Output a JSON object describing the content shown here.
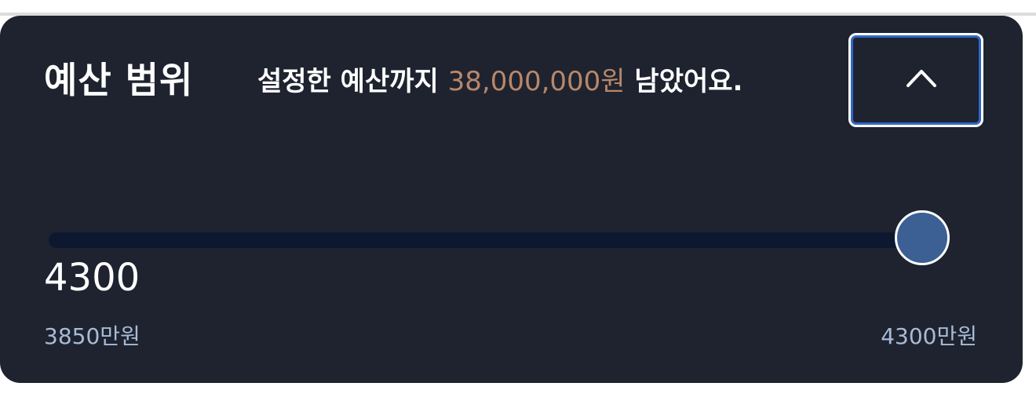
{
  "budget": {
    "title": "예산 범위",
    "message_prefix": "설정한 예산까지 ",
    "message_amount": "38,000,000원",
    "message_suffix": " 남았어요.",
    "collapse_icon": "chevron-up-icon",
    "slider": {
      "value": 4300,
      "value_label": "4300",
      "min": 3850,
      "max": 4300,
      "min_label": "3850만원",
      "max_label": "4300만원"
    },
    "colors": {
      "card_bg": "#1e232f",
      "amount": "#b98769",
      "button_border": "#2f68c7",
      "thumb": "#3c5f94",
      "track": "#0d1830",
      "range_label": "#a8bbd6"
    }
  }
}
